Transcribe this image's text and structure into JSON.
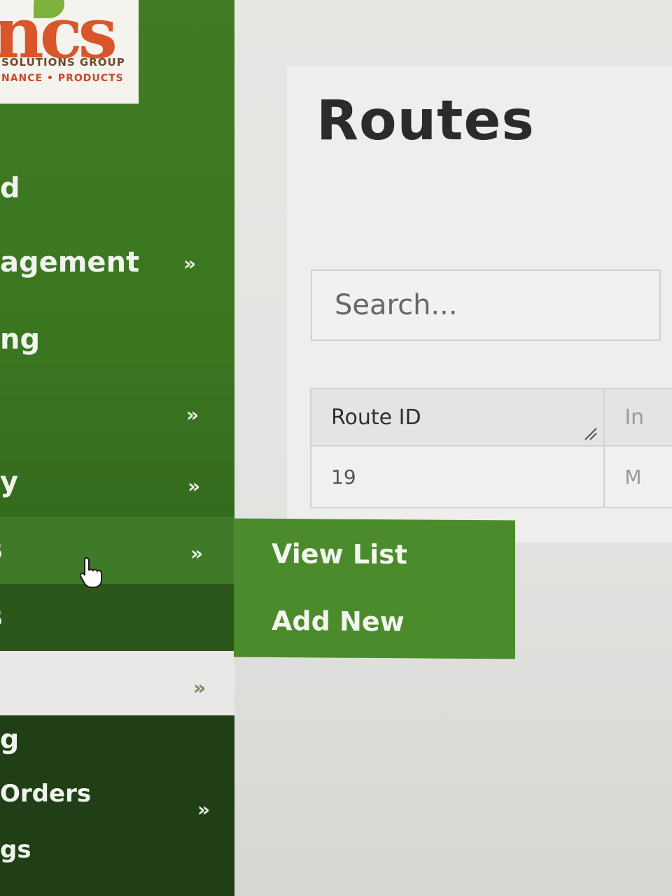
{
  "page": {
    "title": "Routes"
  },
  "search": {
    "placeholder": "Search..."
  },
  "table": {
    "columns": [
      "Route ID",
      "In"
    ],
    "rows": [
      [
        "19",
        "M"
      ]
    ]
  },
  "logo": {
    "mark": "ncs",
    "line1": "SOLUTIONS GROUP",
    "line2": "NANCE • PRODUCTS"
  },
  "sidebar": {
    "items": [
      {
        "label": "d",
        "has_submenu": false
      },
      {
        "label": "agement",
        "has_submenu": true
      },
      {
        "label": "ng",
        "has_submenu": false
      },
      {
        "label": "",
        "has_submenu": true
      },
      {
        "label": "y",
        "has_submenu": true
      },
      {
        "label": "s",
        "has_submenu": true,
        "state": "hovered"
      },
      {
        "label": "s",
        "has_submenu": false
      },
      {
        "label": "",
        "has_submenu": true
      },
      {
        "label": "g",
        "has_submenu": false
      },
      {
        "label": "Orders",
        "has_submenu": true
      },
      {
        "label": "gs",
        "has_submenu": false
      }
    ],
    "chevron": "»"
  },
  "flyout": {
    "items": [
      {
        "label": "View List"
      },
      {
        "label": "Add New"
      }
    ]
  },
  "colors": {
    "sidebar_green": "#3a7520",
    "flyout_green": "#4b8b2b",
    "dark_green": "#2b571b",
    "accent_orange": "#d9552a"
  }
}
